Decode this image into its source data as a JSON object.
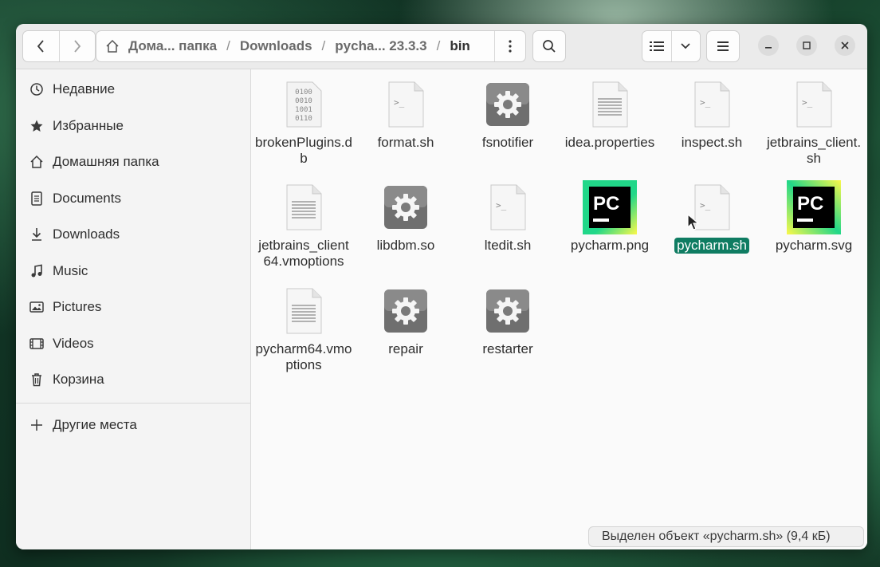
{
  "path": {
    "segments": [
      "Дома... папка",
      "Downloads",
      "pycha... 23.3.3",
      "bin"
    ]
  },
  "sidebar": {
    "items": [
      {
        "label": "Недавние",
        "icon": "clock-icon"
      },
      {
        "label": "Избранные",
        "icon": "star-icon"
      },
      {
        "label": "Домашняя папка",
        "icon": "home-icon"
      },
      {
        "label": "Documents",
        "icon": "document-icon"
      },
      {
        "label": "Downloads",
        "icon": "download-icon"
      },
      {
        "label": "Music",
        "icon": "music-icon"
      },
      {
        "label": "Pictures",
        "icon": "pictures-icon"
      },
      {
        "label": "Videos",
        "icon": "videos-icon"
      },
      {
        "label": "Корзина",
        "icon": "trash-icon"
      }
    ],
    "other_places": {
      "label": "Другие места",
      "icon": "plus-icon"
    }
  },
  "files": [
    {
      "name": "brokenPlugins.db",
      "type": "binary-file-icon",
      "selected": false
    },
    {
      "name": "format.sh",
      "type": "script-file-icon",
      "selected": false
    },
    {
      "name": "fsnotifier",
      "type": "executable-icon",
      "selected": false
    },
    {
      "name": "idea.properties",
      "type": "text-file-icon",
      "selected": false
    },
    {
      "name": "inspect.sh",
      "type": "script-file-icon",
      "selected": false
    },
    {
      "name": "jetbrains_client.sh",
      "type": "script-file-icon",
      "selected": false
    },
    {
      "name": "jetbrains_client64.vmoptions",
      "type": "text-file-icon",
      "selected": false
    },
    {
      "name": "libdbm.so",
      "type": "executable-icon",
      "selected": false
    },
    {
      "name": "ltedit.sh",
      "type": "script-file-icon",
      "selected": false
    },
    {
      "name": "pycharm.png",
      "type": "pycharm-image-icon",
      "selected": false
    },
    {
      "name": "pycharm.sh",
      "type": "script-file-icon",
      "selected": true
    },
    {
      "name": "pycharm.svg",
      "type": "pycharm-image-icon",
      "selected": false
    },
    {
      "name": "pycharm64.vmoptions",
      "type": "text-file-icon",
      "selected": false
    },
    {
      "name": "repair",
      "type": "executable-icon",
      "selected": false
    },
    {
      "name": "restarter",
      "type": "executable-icon",
      "selected": false
    }
  ],
  "status": {
    "text": "Выделен объект «pycharm.sh» (9,4 кБ)"
  },
  "colors": {
    "selection": "#0f7c62",
    "accent_green": "#21d789",
    "accent_yellow": "#fcf84a"
  }
}
